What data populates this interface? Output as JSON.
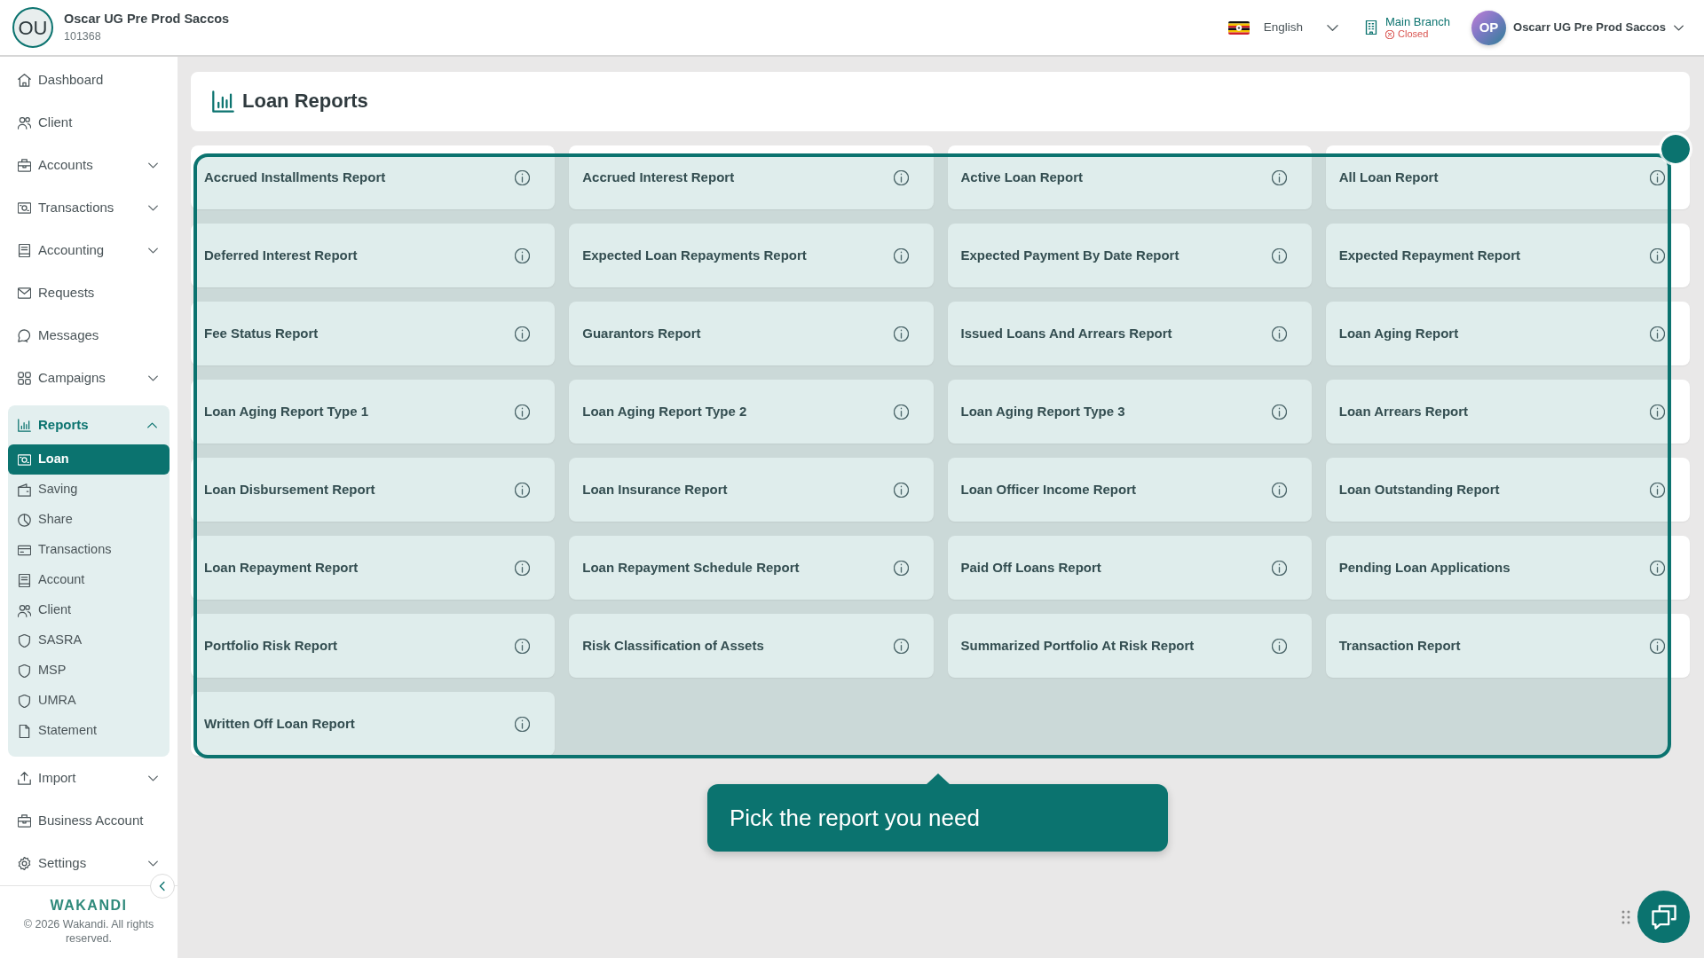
{
  "header": {
    "organization": {
      "initials": "OU",
      "name": "Oscar UG Pre Prod Saccos",
      "code": "101368"
    },
    "language": {
      "label": "English"
    },
    "branch": {
      "name": "Main Branch",
      "status": "Closed",
      "open": false
    },
    "user": {
      "initials": "OP",
      "name": "Oscarr UG Pre Prod Saccos"
    }
  },
  "sidebar": {
    "items": [
      {
        "label": "Dashboard",
        "kind": "link",
        "selected": false
      },
      {
        "label": "Client",
        "kind": "link",
        "selected": false
      },
      {
        "label": "Accounts",
        "kind": "group",
        "selected": false,
        "expanded": false
      },
      {
        "label": "Transactions",
        "kind": "group",
        "selected": false,
        "expanded": false
      },
      {
        "label": "Accounting",
        "kind": "group",
        "selected": false,
        "expanded": false
      },
      {
        "label": "Requests",
        "kind": "link",
        "selected": false
      },
      {
        "label": "Messages",
        "kind": "link",
        "selected": false
      },
      {
        "label": "Campaigns",
        "kind": "group",
        "selected": false,
        "expanded": false
      },
      {
        "label": "Reports",
        "kind": "group",
        "selected": true,
        "expanded": true,
        "children": [
          {
            "label": "Loan",
            "selected": true
          },
          {
            "label": "Saving",
            "selected": false
          },
          {
            "label": "Share",
            "selected": false
          },
          {
            "label": "Transactions",
            "selected": false
          },
          {
            "label": "Account",
            "selected": false
          },
          {
            "label": "Client",
            "selected": false
          },
          {
            "label": "SASRA",
            "selected": false
          },
          {
            "label": "MSP",
            "selected": false
          },
          {
            "label": "UMRA",
            "selected": false
          },
          {
            "label": "Statement",
            "selected": false
          }
        ]
      },
      {
        "label": "Import",
        "kind": "group",
        "selected": false,
        "expanded": false
      },
      {
        "label": "Business Account",
        "kind": "link",
        "selected": false
      },
      {
        "label": "Settings",
        "kind": "group",
        "selected": false,
        "expanded": false
      }
    ],
    "footer": {
      "brand": "WAKANDI",
      "copyright": "© 2026 Wakandi. All rights reserved."
    }
  },
  "page": {
    "title": "Loan Reports",
    "reports": [
      {
        "title": "Accrued Installments Report"
      },
      {
        "title": "Accrued Interest Report"
      },
      {
        "title": "Active Loan Report"
      },
      {
        "title": "All Loan Report"
      },
      {
        "title": "Deferred Interest Report"
      },
      {
        "title": "Expected Loan Repayments Report"
      },
      {
        "title": "Expected Payment By Date Report"
      },
      {
        "title": "Expected Repayment Report"
      },
      {
        "title": "Fee Status Report"
      },
      {
        "title": "Guarantors Report"
      },
      {
        "title": "Issued Loans And Arrears Report"
      },
      {
        "title": "Loan Aging Report"
      },
      {
        "title": "Loan Aging Report Type 1"
      },
      {
        "title": "Loan Aging Report Type 2"
      },
      {
        "title": "Loan Aging Report Type 3"
      },
      {
        "title": "Loan Arrears Report"
      },
      {
        "title": "Loan Disbursement Report"
      },
      {
        "title": "Loan Insurance Report"
      },
      {
        "title": "Loan Officer Income Report"
      },
      {
        "title": "Loan Outstanding Report"
      },
      {
        "title": "Loan Repayment Report"
      },
      {
        "title": "Loan Repayment Schedule Report"
      },
      {
        "title": "Paid Off Loans Report"
      },
      {
        "title": "Pending Loan Applications"
      },
      {
        "title": "Portfolio Risk Report"
      },
      {
        "title": "Risk Classification of Assets"
      },
      {
        "title": "Summarized Portfolio At Risk Report"
      },
      {
        "title": "Transaction Report"
      },
      {
        "title": "Written Off Loan Report"
      }
    ]
  },
  "tour": {
    "text": "Pick the report you need"
  }
}
